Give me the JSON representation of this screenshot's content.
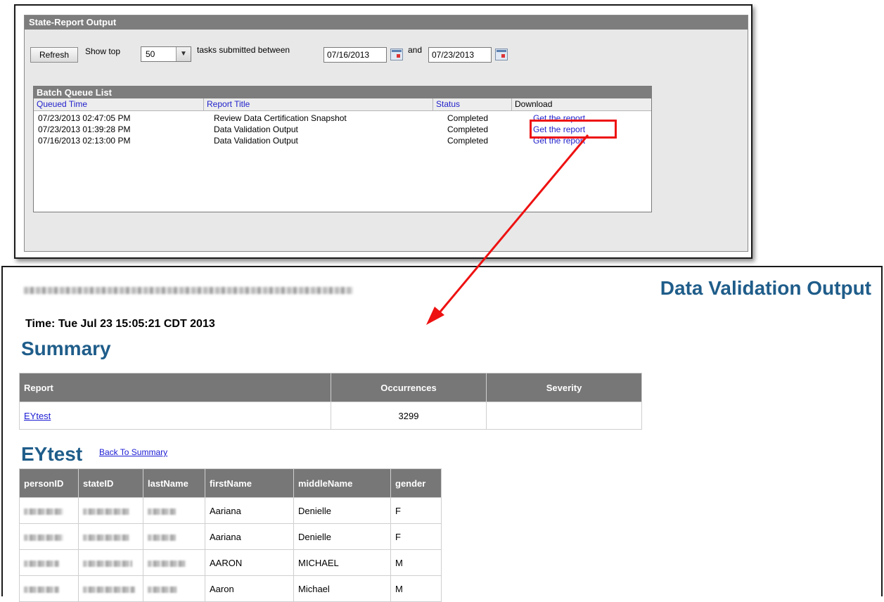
{
  "top_panel": {
    "title": "State-Report Output",
    "refresh_label": "Refresh",
    "show_top_label": "Show top",
    "show_top_value": "50",
    "tasks_label": "tasks submitted between",
    "date_from": "07/16/2013",
    "and_label": "and",
    "date_to": "07/23/2013",
    "batch_queue": {
      "title": "Batch Queue List",
      "columns": [
        "Queued Time",
        "Report Title",
        "Status",
        "Download"
      ],
      "rows": [
        {
          "time": "07/23/2013 02:47:05 PM",
          "title": "Review Data Certification Snapshot",
          "status": "Completed",
          "download": "Get the report"
        },
        {
          "time": "07/23/2013 01:39:28 PM",
          "title": "Data Validation Output",
          "status": "Completed",
          "download": "Get the report"
        },
        {
          "time": "07/16/2013 02:13:00 PM",
          "title": "Data Validation Output",
          "status": "Completed",
          "download": "Get the report"
        }
      ]
    }
  },
  "bottom_panel": {
    "title": "Data Validation Output",
    "time": "Time: Tue Jul 23 15:05:21 CDT 2013",
    "summary_heading": "Summary",
    "summary_columns": [
      "Report",
      "Occurrences",
      "Severity"
    ],
    "summary_row": {
      "report": "EYtest",
      "occurrences": "3299",
      "severity": ""
    },
    "eytest_heading": "EYtest",
    "back_link": "Back To Summary",
    "eytest_columns": [
      "personID",
      "stateID",
      "lastName",
      "firstName",
      "middleName",
      "gender"
    ],
    "eytest_rows": [
      {
        "firstName": "Aariana",
        "middleName": "Denielle",
        "gender": "F"
      },
      {
        "firstName": "Aariana",
        "middleName": "Denielle",
        "gender": "F"
      },
      {
        "firstName": "AARON",
        "middleName": "MICHAEL",
        "gender": "M"
      },
      {
        "firstName": "Aaron",
        "middleName": "Michael",
        "gender": "M"
      }
    ]
  },
  "colors": {
    "heading_blue": "#1f5d8a",
    "link_blue": "#1b1bd4",
    "highlight_red": "#ee1111",
    "header_gray": "#777777"
  }
}
